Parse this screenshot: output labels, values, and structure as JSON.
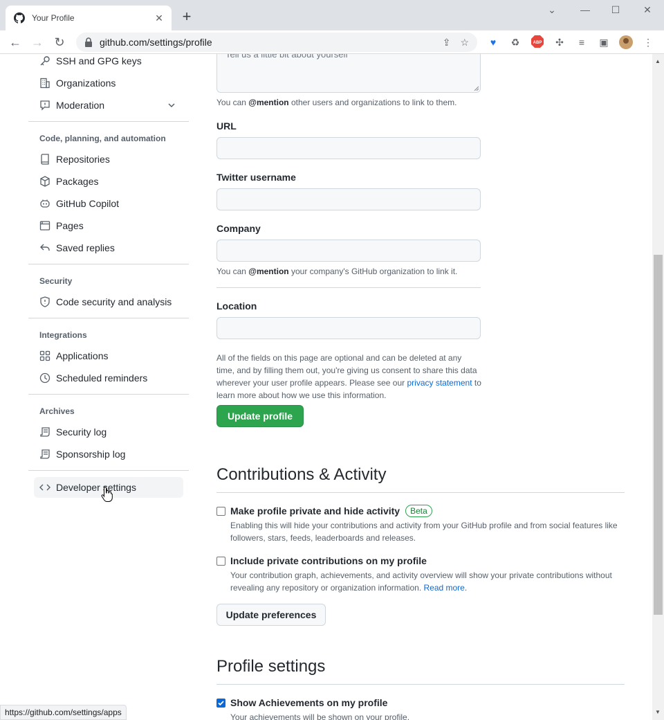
{
  "browser": {
    "tab_title": "Your Profile",
    "url": "github.com/settings/profile",
    "status_url": "https://github.com/settings/apps"
  },
  "sidebar": {
    "top_items": [
      {
        "label": "SSH and GPG keys",
        "icon": "key-icon"
      },
      {
        "label": "Organizations",
        "icon": "organization-icon"
      },
      {
        "label": "Moderation",
        "icon": "report-icon"
      }
    ],
    "section_code": {
      "heading": "Code, planning, and automation",
      "items": [
        {
          "label": "Repositories",
          "icon": "repo-icon"
        },
        {
          "label": "Packages",
          "icon": "package-icon"
        },
        {
          "label": "GitHub Copilot",
          "icon": "copilot-icon"
        },
        {
          "label": "Pages",
          "icon": "browser-icon"
        },
        {
          "label": "Saved replies",
          "icon": "reply-icon"
        }
      ]
    },
    "section_security": {
      "heading": "Security",
      "items": [
        {
          "label": "Code security and analysis",
          "icon": "shield-icon"
        }
      ]
    },
    "section_integrations": {
      "heading": "Integrations",
      "items": [
        {
          "label": "Applications",
          "icon": "apps-icon"
        },
        {
          "label": "Scheduled reminders",
          "icon": "clock-icon"
        }
      ]
    },
    "section_archives": {
      "heading": "Archives",
      "items": [
        {
          "label": "Security log",
          "icon": "log-icon"
        },
        {
          "label": "Sponsorship log",
          "icon": "log-icon"
        }
      ]
    },
    "developer_settings": {
      "label": "Developer settings",
      "icon": "code-icon"
    }
  },
  "form": {
    "bio_placeholder": "Tell us a little bit about yourself",
    "bio_note_pre": "You can ",
    "bio_note_mention": "@mention",
    "bio_note_post": " other users and organizations to link to them.",
    "url_label": "URL",
    "twitter_label": "Twitter username",
    "company_label": "Company",
    "company_note_pre": "You can ",
    "company_note_mention": "@mention",
    "company_note_post": " your company's GitHub organization to link it.",
    "location_label": "Location",
    "consent_line1": "All of the fields on this page are optional and can be deleted at any",
    "consent_line2": "time, and by filling them out, you're giving us consent to share this data",
    "consent_line3_pre": "wherever your user profile appears. Please see our ",
    "consent_link": "privacy statement",
    "consent_line3_post": " to",
    "consent_line4": "learn more about how we use this information.",
    "update_button": "Update profile"
  },
  "contributions": {
    "heading": "Contributions & Activity",
    "private_label": "Make profile private and hide activity",
    "private_badge": "Beta",
    "private_checked": false,
    "private_note_line1": "Enabling this will hide your contributions and activity from your GitHub profile and from social features like",
    "private_note_line2": "followers, stars, feeds, leaderboards and releases.",
    "include_label": "Include private contributions on my profile",
    "include_checked": false,
    "include_note_line1": "Your contribution graph, achievements, and activity overview will show your private contributions without",
    "include_note_line2_pre": "revealing any repository or organization information. ",
    "include_note_link": "Read more.",
    "update_button": "Update preferences"
  },
  "profile_settings": {
    "heading": "Profile settings",
    "achievements_label": "Show Achievements on my profile",
    "achievements_checked": true,
    "achievements_note": "Your achievements will be shown on your profile."
  }
}
